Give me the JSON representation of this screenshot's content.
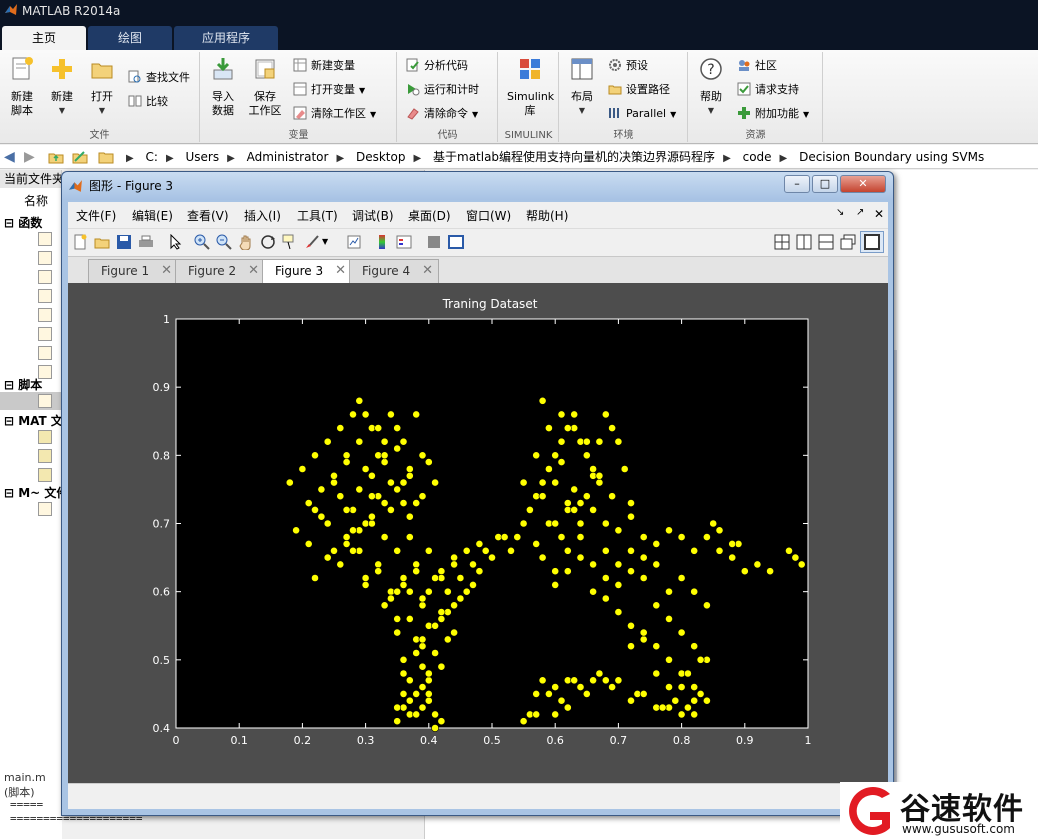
{
  "app": {
    "title": "MATLAB R2014a"
  },
  "ribbon_tabs": [
    {
      "label": "主页",
      "active": true
    },
    {
      "label": "绘图",
      "active": false
    },
    {
      "label": "应用程序",
      "active": false
    }
  ],
  "ribbon": {
    "file": {
      "new_script": "新建\n脚本",
      "new": "新建",
      "open": "打开",
      "find_files": "查找文件",
      "compare": "比较",
      "group": "文件"
    },
    "variable": {
      "import": "导入\n数据",
      "save_ws": "保存\n工作区",
      "new_var": "新建变量",
      "open_var": "打开变量",
      "clear_ws": "清除工作区",
      "group": "变量"
    },
    "code": {
      "analyze": "分析代码",
      "run_time": "运行和计时",
      "clear_cmd": "清除命令",
      "group": "代码"
    },
    "simulink": {
      "lib": "Simulink\n库",
      "group": "SIMULINK"
    },
    "env": {
      "layout": "布局",
      "prefs": "预设",
      "set_path": "设置路径",
      "parallel": "Parallel",
      "group": "环境"
    },
    "resources": {
      "help": "帮助",
      "community": "社区",
      "support": "请求支持",
      "addons": "附加功能",
      "group": "资源"
    }
  },
  "breadcrumbs": [
    "C:",
    "Users",
    "Administrator",
    "Desktop",
    "基于matlab编程使用支持向量机的决策边界源码程序",
    "code",
    "Decision Boundary using SVMs"
  ],
  "left_panel": {
    "header": "当前文件夹",
    "name_col": "名称",
    "sections": [
      "函数",
      "脚本",
      "MAT 文件",
      "M~ 文件"
    ],
    "cmd_label": "main.m (脚本)"
  },
  "bottom_text": "=====\n====================",
  "figure": {
    "window_title": "图形 - Figure 3",
    "menus": [
      "文件(F)",
      "编辑(E)",
      "查看(V)",
      "插入(I)",
      "工具(T)",
      "调试(B)",
      "桌面(D)",
      "窗口(W)",
      "帮助(H)"
    ],
    "tabs": [
      {
        "label": "Figure 1",
        "active": false
      },
      {
        "label": "Figure 2",
        "active": false
      },
      {
        "label": "Figure 3",
        "active": true
      },
      {
        "label": "Figure 4",
        "active": false
      }
    ]
  },
  "watermark": {
    "brand": "谷速软件",
    "url": "www.gususoft.com"
  },
  "colors": {
    "marker": "#ffff00",
    "axes_bg": "#000000",
    "figure_bg": "#4d4d4d",
    "accent": "#1f3a66"
  },
  "chart_data": {
    "type": "scatter",
    "title": "Traning Dataset",
    "xlabel": "",
    "ylabel": "",
    "xlim": [
      0,
      1
    ],
    "ylim": [
      0.4,
      1
    ],
    "xticks": [
      "0",
      "0.1",
      "0.2",
      "0.3",
      "0.4",
      "0.5",
      "0.6",
      "0.7",
      "0.8",
      "0.9",
      "1"
    ],
    "yticks": [
      "0.4",
      "0.5",
      "0.6",
      "0.7",
      "0.8",
      "0.9",
      "1"
    ],
    "grid": false,
    "series": [
      {
        "color": "#ffff00",
        "x": [
          0.18,
          0.2,
          0.22,
          0.24,
          0.25,
          0.26,
          0.27,
          0.28,
          0.29,
          0.3,
          0.31,
          0.32,
          0.33,
          0.34,
          0.35,
          0.36,
          0.37,
          0.38,
          0.39,
          0.4,
          0.21,
          0.23,
          0.25,
          0.27,
          0.29,
          0.31,
          0.33,
          0.35,
          0.37,
          0.39,
          0.41,
          0.22,
          0.24,
          0.26,
          0.28,
          0.3,
          0.32,
          0.34,
          0.36,
          0.38,
          0.19,
          0.21,
          0.23,
          0.25,
          0.27,
          0.29,
          0.31,
          0.33,
          0.35,
          0.37,
          0.26,
          0.28,
          0.3,
          0.32,
          0.34,
          0.36,
          0.38,
          0.4,
          0.42,
          0.44,
          0.3,
          0.32,
          0.34,
          0.36,
          0.38,
          0.4,
          0.42,
          0.44,
          0.46,
          0.48,
          0.33,
          0.35,
          0.37,
          0.39,
          0.41,
          0.43,
          0.45,
          0.47,
          0.49,
          0.51,
          0.35,
          0.37,
          0.39,
          0.41,
          0.43,
          0.45,
          0.47,
          0.36,
          0.38,
          0.4,
          0.42,
          0.44,
          0.37,
          0.39,
          0.41,
          0.43,
          0.38,
          0.4,
          0.42,
          0.36,
          0.38,
          0.4,
          0.35,
          0.37,
          0.39,
          0.41,
          0.24,
          0.27,
          0.29,
          0.31,
          0.33,
          0.35,
          0.22,
          0.52,
          0.53,
          0.5,
          0.48,
          0.46,
          0.44,
          0.42,
          0.54,
          0.55,
          0.56,
          0.57,
          0.58,
          0.59,
          0.6,
          0.61,
          0.62,
          0.63,
          0.64,
          0.65,
          0.66,
          0.67,
          0.68,
          0.69,
          0.7,
          0.71,
          0.72,
          0.55,
          0.57,
          0.59,
          0.61,
          0.63,
          0.65,
          0.67,
          0.69,
          0.56,
          0.58,
          0.6,
          0.62,
          0.64,
          0.66,
          0.68,
          0.57,
          0.59,
          0.61,
          0.63,
          0.65,
          0.67,
          0.58,
          0.6,
          0.62,
          0.64,
          0.66,
          0.68,
          0.7,
          0.72,
          0.74,
          0.6,
          0.62,
          0.64,
          0.66,
          0.68,
          0.7,
          0.72,
          0.74,
          0.76,
          0.78,
          0.68,
          0.7,
          0.72,
          0.74,
          0.76,
          0.78,
          0.8,
          0.82,
          0.84,
          0.86,
          0.88,
          0.7,
          0.72,
          0.74,
          0.76,
          0.78,
          0.8,
          0.82,
          0.84,
          0.72,
          0.74,
          0.76,
          0.78,
          0.8,
          0.82,
          0.84,
          0.76,
          0.78,
          0.8,
          0.82,
          0.84,
          0.8,
          0.82,
          0.78,
          0.8,
          0.81,
          0.83,
          0.9,
          0.89,
          0.92,
          0.94,
          0.98,
          0.99,
          0.97,
          0.88,
          0.86,
          0.85,
          0.56,
          0.57,
          0.58,
          0.59,
          0.6,
          0.61,
          0.62,
          0.63,
          0.64,
          0.65,
          0.66,
          0.67,
          0.68,
          0.69,
          0.55,
          0.57,
          0.6,
          0.62,
          0.7,
          0.72,
          0.73,
          0.74,
          0.76,
          0.77,
          0.79,
          0.8,
          0.82,
          0.83,
          0.84,
          0.78,
          0.81,
          0.36,
          0.37,
          0.38,
          0.39,
          0.4,
          0.41,
          0.35,
          0.36,
          0.38,
          0.4,
          0.42,
          0.37,
          0.39,
          0.41,
          0.35,
          0.39,
          0.29,
          0.3,
          0.32,
          0.33,
          0.34,
          0.36,
          0.37,
          0.31,
          0.27,
          0.28,
          0.6,
          0.61,
          0.63,
          0.64,
          0.66,
          0.65,
          0.67,
          0.62,
          0.58,
          0.6,
          0.62
        ],
        "y": [
          0.76,
          0.78,
          0.8,
          0.82,
          0.76,
          0.84,
          0.8,
          0.86,
          0.82,
          0.86,
          0.84,
          0.8,
          0.82,
          0.86,
          0.84,
          0.82,
          0.78,
          0.86,
          0.8,
          0.79,
          0.73,
          0.75,
          0.77,
          0.79,
          0.75,
          0.77,
          0.79,
          0.81,
          0.77,
          0.74,
          0.76,
          0.72,
          0.7,
          0.74,
          0.72,
          0.7,
          0.74,
          0.72,
          0.76,
          0.73,
          0.69,
          0.67,
          0.71,
          0.66,
          0.68,
          0.66,
          0.7,
          0.68,
          0.66,
          0.68,
          0.64,
          0.66,
          0.62,
          0.64,
          0.6,
          0.62,
          0.64,
          0.66,
          0.63,
          0.65,
          0.61,
          0.63,
          0.59,
          0.61,
          0.63,
          0.6,
          0.62,
          0.64,
          0.66,
          0.67,
          0.58,
          0.56,
          0.6,
          0.58,
          0.62,
          0.6,
          0.62,
          0.64,
          0.66,
          0.68,
          0.54,
          0.56,
          0.52,
          0.55,
          0.57,
          0.59,
          0.61,
          0.5,
          0.53,
          0.55,
          0.57,
          0.54,
          0.47,
          0.49,
          0.51,
          0.53,
          0.45,
          0.47,
          0.49,
          0.43,
          0.45,
          0.44,
          0.41,
          0.42,
          0.43,
          0.42,
          0.65,
          0.67,
          0.69,
          0.71,
          0.73,
          0.75,
          0.62,
          0.68,
          0.66,
          0.65,
          0.63,
          0.6,
          0.58,
          0.56,
          0.68,
          0.7,
          0.72,
          0.74,
          0.76,
          0.78,
          0.8,
          0.82,
          0.84,
          0.86,
          0.82,
          0.8,
          0.78,
          0.82,
          0.86,
          0.84,
          0.82,
          0.78,
          0.73,
          0.76,
          0.8,
          0.84,
          0.86,
          0.84,
          0.8,
          0.76,
          0.74,
          0.72,
          0.74,
          0.76,
          0.72,
          0.7,
          0.72,
          0.7,
          0.67,
          0.7,
          0.68,
          0.72,
          0.74,
          0.76,
          0.65,
          0.63,
          0.66,
          0.68,
          0.64,
          0.66,
          0.69,
          0.71,
          0.68,
          0.61,
          0.63,
          0.65,
          0.6,
          0.62,
          0.64,
          0.66,
          0.62,
          0.64,
          0.6,
          0.59,
          0.61,
          0.63,
          0.65,
          0.67,
          0.69,
          0.68,
          0.66,
          0.68,
          0.66,
          0.65,
          0.57,
          0.55,
          0.53,
          0.58,
          0.6,
          0.62,
          0.6,
          0.58,
          0.52,
          0.54,
          0.52,
          0.56,
          0.54,
          0.52,
          0.5,
          0.48,
          0.5,
          0.48,
          0.46,
          0.44,
          0.46,
          0.44,
          0.43,
          0.42,
          0.48,
          0.5,
          0.63,
          0.67,
          0.64,
          0.63,
          0.65,
          0.64,
          0.66,
          0.67,
          0.69,
          0.7,
          0.42,
          0.45,
          0.47,
          0.45,
          0.46,
          0.44,
          0.47,
          0.47,
          0.46,
          0.45,
          0.47,
          0.48,
          0.47,
          0.46,
          0.41,
          0.42,
          0.42,
          0.43,
          0.47,
          0.44,
          0.45,
          0.45,
          0.43,
          0.43,
          0.44,
          0.42,
          0.42,
          0.45,
          0.44,
          0.46,
          0.43,
          0.45,
          0.44,
          0.42,
          0.46,
          0.48,
          0.4,
          0.43,
          0.48,
          0.51,
          0.45,
          0.41,
          0.56,
          0.59,
          0.55,
          0.6,
          0.53,
          0.88,
          0.78,
          0.84,
          0.8,
          0.76,
          0.73,
          0.71,
          0.74,
          0.72,
          0.69,
          0.7,
          0.79,
          0.75,
          0.73,
          0.77,
          0.82,
          0.77,
          0.84,
          0.88,
          0.8,
          0.73
        ]
      }
    ]
  }
}
